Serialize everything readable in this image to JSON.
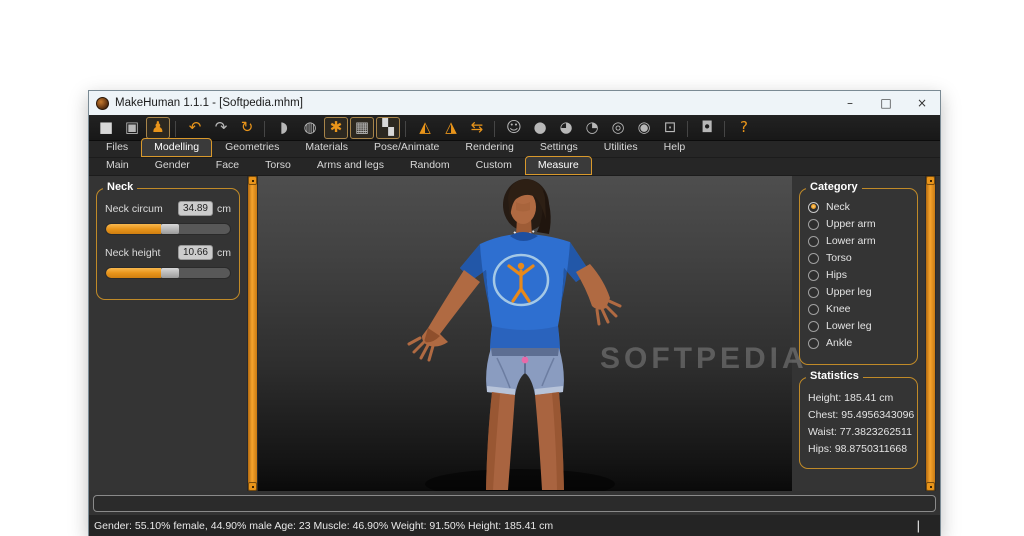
{
  "window": {
    "title": "MakeHuman 1.1.1 - [Softpedia.mhm]",
    "controls": {
      "minimize": "–",
      "maximize": "□",
      "close": "×"
    }
  },
  "toolbar": {
    "icons": [
      {
        "name": "new-document-icon",
        "glyph": "■",
        "color": "#d8d8d8",
        "boxed": false,
        "sep_after": false
      },
      {
        "name": "save-icon",
        "glyph": "▣",
        "color": "#b8b8b8",
        "boxed": false,
        "sep_after": false
      },
      {
        "name": "load-icon",
        "glyph": "♟",
        "color": "#e8941a",
        "boxed": true,
        "sep_after": true
      },
      {
        "name": "undo-icon",
        "glyph": "↶",
        "color": "#e8941a",
        "boxed": false,
        "sep_after": false
      },
      {
        "name": "redo-icon",
        "glyph": "↷",
        "color": "#b8b8b8",
        "boxed": false,
        "sep_after": false
      },
      {
        "name": "reset-icon",
        "glyph": "↻",
        "color": "#e8941a",
        "boxed": false,
        "sep_after": true
      },
      {
        "name": "smooth-icon",
        "glyph": "◗",
        "color": "#b8b8b8",
        "boxed": false,
        "sep_after": false
      },
      {
        "name": "wireframe-icon",
        "glyph": "◍",
        "color": "#b8b8b8",
        "boxed": false,
        "sep_after": false
      },
      {
        "name": "skeleton-icon",
        "glyph": "✱",
        "color": "#e8941a",
        "boxed": true,
        "sep_after": false
      },
      {
        "name": "pose-grid-icon",
        "glyph": "▦",
        "color": "#b8b8b8",
        "boxed": true,
        "sep_after": false
      },
      {
        "name": "background-checker-icon",
        "glyph": "▚",
        "color": "#d8d8d8",
        "boxed": true,
        "sep_after": true
      },
      {
        "name": "symmetry-right-icon",
        "glyph": "◭",
        "color": "#e8941a",
        "boxed": false,
        "sep_after": false
      },
      {
        "name": "symmetry-left-icon",
        "glyph": "◮",
        "color": "#e8941a",
        "boxed": false,
        "sep_after": false
      },
      {
        "name": "symmetry-both-icon",
        "glyph": "⇆",
        "color": "#e8941a",
        "boxed": false,
        "sep_after": true
      },
      {
        "name": "view-face-icon",
        "glyph": "☺",
        "color": "#b8b8b8",
        "boxed": false,
        "sep_after": false
      },
      {
        "name": "view-head-front-icon",
        "glyph": "●",
        "color": "#b8b8b8",
        "boxed": false,
        "sep_after": false
      },
      {
        "name": "view-head-right-icon",
        "glyph": "◕",
        "color": "#b8b8b8",
        "boxed": false,
        "sep_after": false
      },
      {
        "name": "view-head-left-icon",
        "glyph": "◔",
        "color": "#b8b8b8",
        "boxed": false,
        "sep_after": false
      },
      {
        "name": "view-head-back-icon",
        "glyph": "◎",
        "color": "#b8b8b8",
        "boxed": false,
        "sep_after": false
      },
      {
        "name": "view-body-pair-icon",
        "glyph": "◉",
        "color": "#b8b8b8",
        "boxed": false,
        "sep_after": false
      },
      {
        "name": "view-frame-icon",
        "glyph": "⊡",
        "color": "#b8b8b8",
        "boxed": false,
        "sep_after": true
      },
      {
        "name": "grab-screen-icon",
        "glyph": "◘",
        "color": "#b8b8b8",
        "boxed": false,
        "sep_after": true
      },
      {
        "name": "help-icon",
        "glyph": "?",
        "color": "#e8941a",
        "boxed": false,
        "sep_after": false
      }
    ]
  },
  "tabs_main": [
    {
      "name": "tab-files",
      "label": "Files",
      "active": false
    },
    {
      "name": "tab-modelling",
      "label": "Modelling",
      "active": true
    },
    {
      "name": "tab-geometries",
      "label": "Geometries",
      "active": false
    },
    {
      "name": "tab-materials",
      "label": "Materials",
      "active": false
    },
    {
      "name": "tab-pose-animate",
      "label": "Pose/Animate",
      "active": false
    },
    {
      "name": "tab-rendering",
      "label": "Rendering",
      "active": false
    },
    {
      "name": "tab-settings",
      "label": "Settings",
      "active": false
    },
    {
      "name": "tab-utilities",
      "label": "Utilities",
      "active": false
    },
    {
      "name": "tab-help",
      "label": "Help",
      "active": false
    }
  ],
  "tabs_sub": [
    {
      "name": "subtab-main",
      "label": "Main",
      "active": false
    },
    {
      "name": "subtab-gender",
      "label": "Gender",
      "active": false
    },
    {
      "name": "subtab-face",
      "label": "Face",
      "active": false
    },
    {
      "name": "subtab-torso",
      "label": "Torso",
      "active": false
    },
    {
      "name": "subtab-arms-legs",
      "label": "Arms and legs",
      "active": false
    },
    {
      "name": "subtab-random",
      "label": "Random",
      "active": false
    },
    {
      "name": "subtab-custom",
      "label": "Custom",
      "active": false
    },
    {
      "name": "subtab-measure",
      "label": "Measure",
      "active": true
    }
  ],
  "left_panel": {
    "group_title": "Neck",
    "sliders": [
      {
        "name": "neck-circum-slider",
        "label": "Neck circum",
        "value": "34.89",
        "unit": "cm",
        "fill": "44%"
      },
      {
        "name": "neck-height-slider",
        "label": "Neck height",
        "value": "10.66",
        "unit": "cm",
        "fill": "44%"
      }
    ]
  },
  "right_panel": {
    "category": {
      "title": "Category",
      "options": [
        {
          "name": "radio-neck",
          "label": "Neck",
          "selected": true
        },
        {
          "name": "radio-upper-arm",
          "label": "Upper arm",
          "selected": false
        },
        {
          "name": "radio-lower-arm",
          "label": "Lower arm",
          "selected": false
        },
        {
          "name": "radio-torso",
          "label": "Torso",
          "selected": false
        },
        {
          "name": "radio-hips",
          "label": "Hips",
          "selected": false
        },
        {
          "name": "radio-upper-leg",
          "label": "Upper leg",
          "selected": false
        },
        {
          "name": "radio-knee",
          "label": "Knee",
          "selected": false
        },
        {
          "name": "radio-lower-leg",
          "label": "Lower leg",
          "selected": false
        },
        {
          "name": "radio-ankle",
          "label": "Ankle",
          "selected": false
        }
      ]
    },
    "statistics": {
      "title": "Statistics",
      "lines": [
        "Height: 185.41 cm",
        "Chest: 95.4956343096",
        "Waist: 77.3823262511",
        "Hips: 98.8750311668"
      ]
    }
  },
  "status_bar": {
    "text": "Gender: 55.10% female, 44.90% male Age: 23 Muscle: 46.90% Weight: 91.50% Height: 185.41 cm",
    "caret": "|"
  },
  "watermark": "SOFTPEDIA",
  "colors": {
    "accent_orange": "#e8941a",
    "group_border": "#c08a28",
    "panel_bg": "#343434",
    "toolbar_bg": "#1c1c1c",
    "titlebar_bg": "#eef4f8",
    "shirt_blue": "#2e6fd0",
    "skin": "#b06a42",
    "denim": "#8a9cc0"
  }
}
